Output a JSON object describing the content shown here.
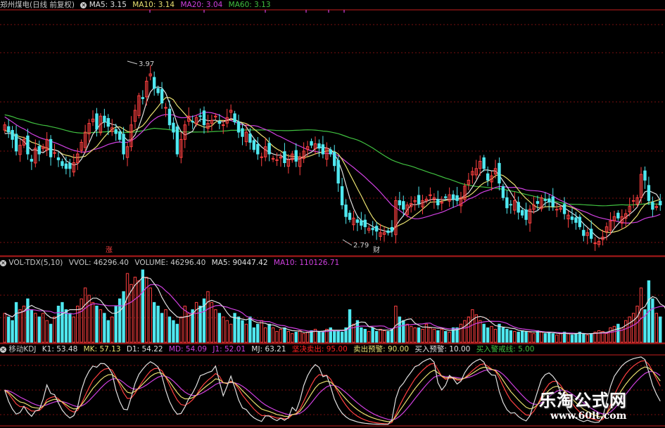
{
  "price_panel": {
    "title": "郑州煤电(日线 前复权)",
    "ma5_label": "MA5: 3.15",
    "ma10_label": "MA10: 3.14",
    "ma20_label": "MA20: 3.04",
    "ma60_label": "MA60: 3.13",
    "high_label": "3.97",
    "low_label": "2.79",
    "marker_up": "涨",
    "marker_fin": "财"
  },
  "vol_panel": {
    "name": "VOL-TDX(5,10)",
    "vvol_label": "VVOL: 46296.40",
    "volume_label": "VOLUME: 46296.40",
    "ma5_label": "MA5: 90447.42",
    "ma10_label": "MA10: 110126.71"
  },
  "kdj_panel": {
    "name": "移动KDJ",
    "k1": "K1: 53.48",
    "mk": "MK: 57.13",
    "d1": "D1: 54.22",
    "md": "MD: 54.09",
    "j1": "J1: 52.01",
    "mj": "MJ: 63.21",
    "sell_decision": "坚决卖出: 95.00",
    "sell_warning": "卖出预警: 90.00",
    "buy_warning": "买入预警: 10.00",
    "buy_alert": "买入警戒线: 5.00"
  },
  "watermark": {
    "title": "乐淘公式网",
    "url": "www.60lt.com"
  },
  "colors": {
    "up": "#ff4040",
    "down": "#4fe8f0",
    "ma5": "#e0e0e0",
    "ma10": "#e8e070",
    "ma20": "#d040e0",
    "ma60": "#40c040",
    "divider": "#a01818",
    "grid": "#7a1010",
    "vol_ma5": "#e0e0e0",
    "vol_ma10": "#d040e0",
    "sell_decision": "#ff2020",
    "sell_warning": "#e8e070",
    "buy_warning": "#e0e0e0",
    "buy_alert": "#40c040"
  },
  "chart_data": {
    "type": "candlestick",
    "y_range": [
      2.72,
      4.38
    ],
    "closes": [
      3.6,
      3.55,
      3.5,
      3.42,
      3.46,
      3.5,
      3.4,
      3.35,
      3.44,
      3.4,
      3.45,
      3.5,
      3.38,
      3.41,
      3.36,
      3.32,
      3.3,
      3.3,
      3.34,
      3.4,
      3.48,
      3.55,
      3.61,
      3.64,
      3.57,
      3.66,
      3.62,
      3.59,
      3.58,
      3.54,
      3.5,
      3.4,
      3.45,
      3.6,
      3.7,
      3.8,
      3.78,
      3.9,
      3.95,
      3.85,
      3.82,
      3.75,
      3.72,
      3.6,
      3.55,
      3.4,
      3.5,
      3.6,
      3.66,
      3.62,
      3.65,
      3.66,
      3.6,
      3.61,
      3.63,
      3.66,
      3.61,
      3.6,
      3.65,
      3.7,
      3.62,
      3.55,
      3.52,
      3.55,
      3.48,
      3.43,
      3.4,
      3.38,
      3.45,
      3.4,
      3.37,
      3.36,
      3.38,
      3.34,
      3.36,
      3.4,
      3.35,
      3.38,
      3.42,
      3.45,
      3.46,
      3.47,
      3.44,
      3.4,
      3.44,
      3.4,
      3.32,
      3.2,
      3.05,
      2.97,
      2.95,
      2.96,
      2.93,
      2.91,
      2.9,
      2.89,
      2.88,
      2.87,
      2.86,
      2.86,
      2.86,
      2.87,
      3.08,
      3.05,
      3.02,
      3.05,
      3.06,
      3.08,
      3.06,
      3.08,
      3.09,
      3.12,
      3.1,
      3.05,
      3.07,
      3.1,
      3.12,
      3.09,
      3.08,
      3.1,
      3.18,
      3.22,
      3.28,
      3.3,
      3.35,
      3.3,
      3.22,
      3.25,
      3.3,
      3.2,
      3.1,
      3.03,
      3.05,
      3.08,
      3.0,
      2.98,
      2.95,
      3.02,
      3.05,
      3.06,
      3.1,
      3.08,
      3.07,
      3.04,
      3.02,
      3.03,
      2.99,
      2.98,
      2.95,
      2.93,
      2.9,
      2.84,
      2.86,
      2.82,
      2.79,
      2.8,
      2.83,
      2.9,
      2.94,
      2.97,
      2.96,
      2.97,
      2.99,
      3.04,
      3.08,
      3.1,
      3.26,
      3.22,
      3.08,
      3.02,
      3.04,
      3.05
    ],
    "volumes": [
      0.4,
      0.35,
      0.3,
      0.55,
      0.45,
      0.5,
      0.6,
      0.45,
      0.4,
      0.35,
      0.4,
      0.3,
      0.25,
      0.35,
      0.5,
      0.55,
      0.45,
      0.4,
      0.35,
      0.5,
      0.6,
      0.75,
      0.65,
      0.55,
      0.5,
      0.45,
      0.4,
      0.3,
      0.35,
      0.5,
      0.6,
      0.7,
      0.95,
      0.8,
      0.9,
      0.85,
      1.0,
      0.9,
      0.75,
      0.55,
      0.5,
      0.4,
      0.45,
      0.35,
      0.3,
      0.25,
      0.35,
      0.5,
      0.4,
      0.45,
      0.55,
      0.5,
      0.6,
      0.7,
      0.55,
      0.45,
      0.4,
      0.35,
      0.3,
      0.25,
      0.4,
      0.35,
      0.3,
      0.25,
      0.35,
      0.2,
      0.25,
      0.3,
      0.2,
      0.25,
      0.2,
      0.15,
      0.18,
      0.2,
      0.15,
      0.12,
      0.14,
      0.16,
      0.12,
      0.14,
      0.16,
      0.18,
      0.15,
      0.14,
      0.18,
      0.2,
      0.16,
      0.15,
      0.14,
      0.2,
      0.45,
      0.25,
      0.3,
      0.2,
      0.18,
      0.15,
      0.2,
      0.15,
      0.18,
      0.16,
      0.15,
      0.18,
      0.5,
      0.35,
      0.3,
      0.25,
      0.22,
      0.2,
      0.2,
      0.18,
      0.25,
      0.2,
      0.18,
      0.16,
      0.18,
      0.15,
      0.14,
      0.2,
      0.2,
      0.25,
      0.3,
      0.35,
      0.45,
      0.38,
      0.3,
      0.25,
      0.2,
      0.22,
      0.18,
      0.25,
      0.2,
      0.18,
      0.16,
      0.15,
      0.14,
      0.16,
      0.15,
      0.14,
      0.12,
      0.16,
      0.14,
      0.12,
      0.14,
      0.12,
      0.1,
      0.12,
      0.14,
      0.12,
      0.1,
      0.12,
      0.14,
      0.12,
      0.1,
      0.12,
      0.14,
      0.16,
      0.15,
      0.12,
      0.2,
      0.22,
      0.25,
      0.2,
      0.3,
      0.35,
      0.4,
      0.5,
      0.75,
      0.45,
      0.85,
      0.6,
      0.4,
      0.35,
      0.3,
      0.3
    ],
    "annotations": [
      {
        "label": "3.97",
        "value": 3.97
      },
      {
        "label": "2.79",
        "value": 2.79
      }
    ]
  }
}
